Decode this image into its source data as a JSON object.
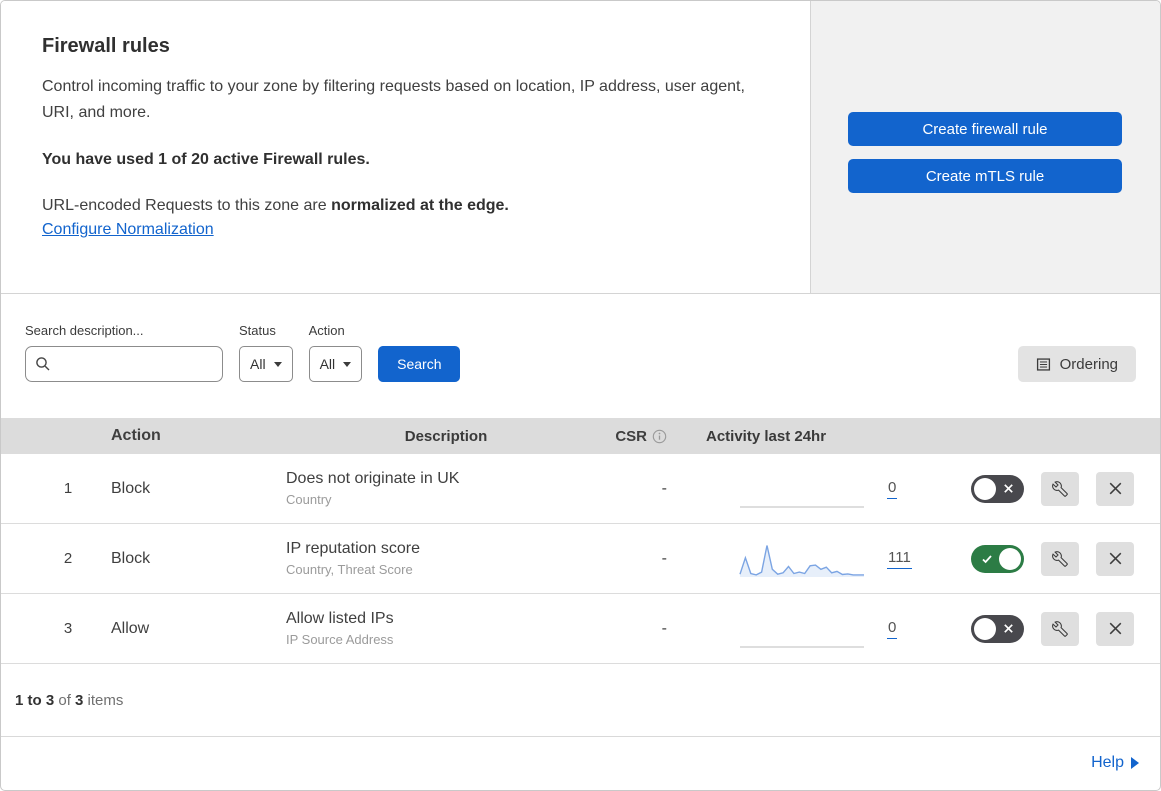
{
  "intro": {
    "title": "Firewall rules",
    "description": "Control incoming traffic to your zone by filtering requests based on location, IP address, user agent, URI, and more.",
    "usage_note": "You have used 1 of 20 active Firewall rules.",
    "normalization_prefix": "URL-encoded Requests to this zone are ",
    "normalization_bold": "normalized at the edge.",
    "normalization_link": "Configure Normalization"
  },
  "actions_panel": {
    "create_firewall_rule_label": "Create firewall rule",
    "create_mtls_rule_label": "Create mTLS rule"
  },
  "filters": {
    "search_label": "Search description...",
    "search_value": "",
    "status_label": "Status",
    "status_selected": "All",
    "action_label": "Action",
    "action_selected": "All",
    "search_button_label": "Search",
    "ordering_button_label": "Ordering"
  },
  "table": {
    "headers": {
      "action": "Action",
      "description": "Description",
      "csr": "CSR",
      "activity": "Activity last 24hr"
    },
    "rows": [
      {
        "priority": "1",
        "action": "Block",
        "description": "Does not originate in UK",
        "match_fields": "Country",
        "csr": "-",
        "activity_count": "0",
        "enabled": false,
        "sparkline": []
      },
      {
        "priority": "2",
        "action": "Block",
        "description": "IP reputation score",
        "match_fields": "Country, Threat Score",
        "csr": "-",
        "activity_count": "111",
        "enabled": true,
        "sparkline": [
          8,
          55,
          10,
          6,
          14,
          90,
          22,
          8,
          12,
          30,
          10,
          14,
          10,
          32,
          34,
          22,
          28,
          12,
          16,
          7,
          9,
          6,
          6,
          6
        ]
      },
      {
        "priority": "3",
        "action": "Allow",
        "description": "Allow listed IPs",
        "match_fields": "IP Source Address",
        "csr": "-",
        "activity_count": "0",
        "enabled": false,
        "sparkline": []
      }
    ]
  },
  "footer": {
    "range": "1 to 3",
    "of_text": " of ",
    "total": "3",
    "items_text": " items"
  },
  "help": {
    "label": "Help"
  },
  "colors": {
    "accent_blue": "#1264cd",
    "link_blue": "#1264cd",
    "toggle_on_green": "#2c7c45",
    "toggle_off_gray": "#48484d",
    "sparkline_blue": "#7ba4e3"
  }
}
